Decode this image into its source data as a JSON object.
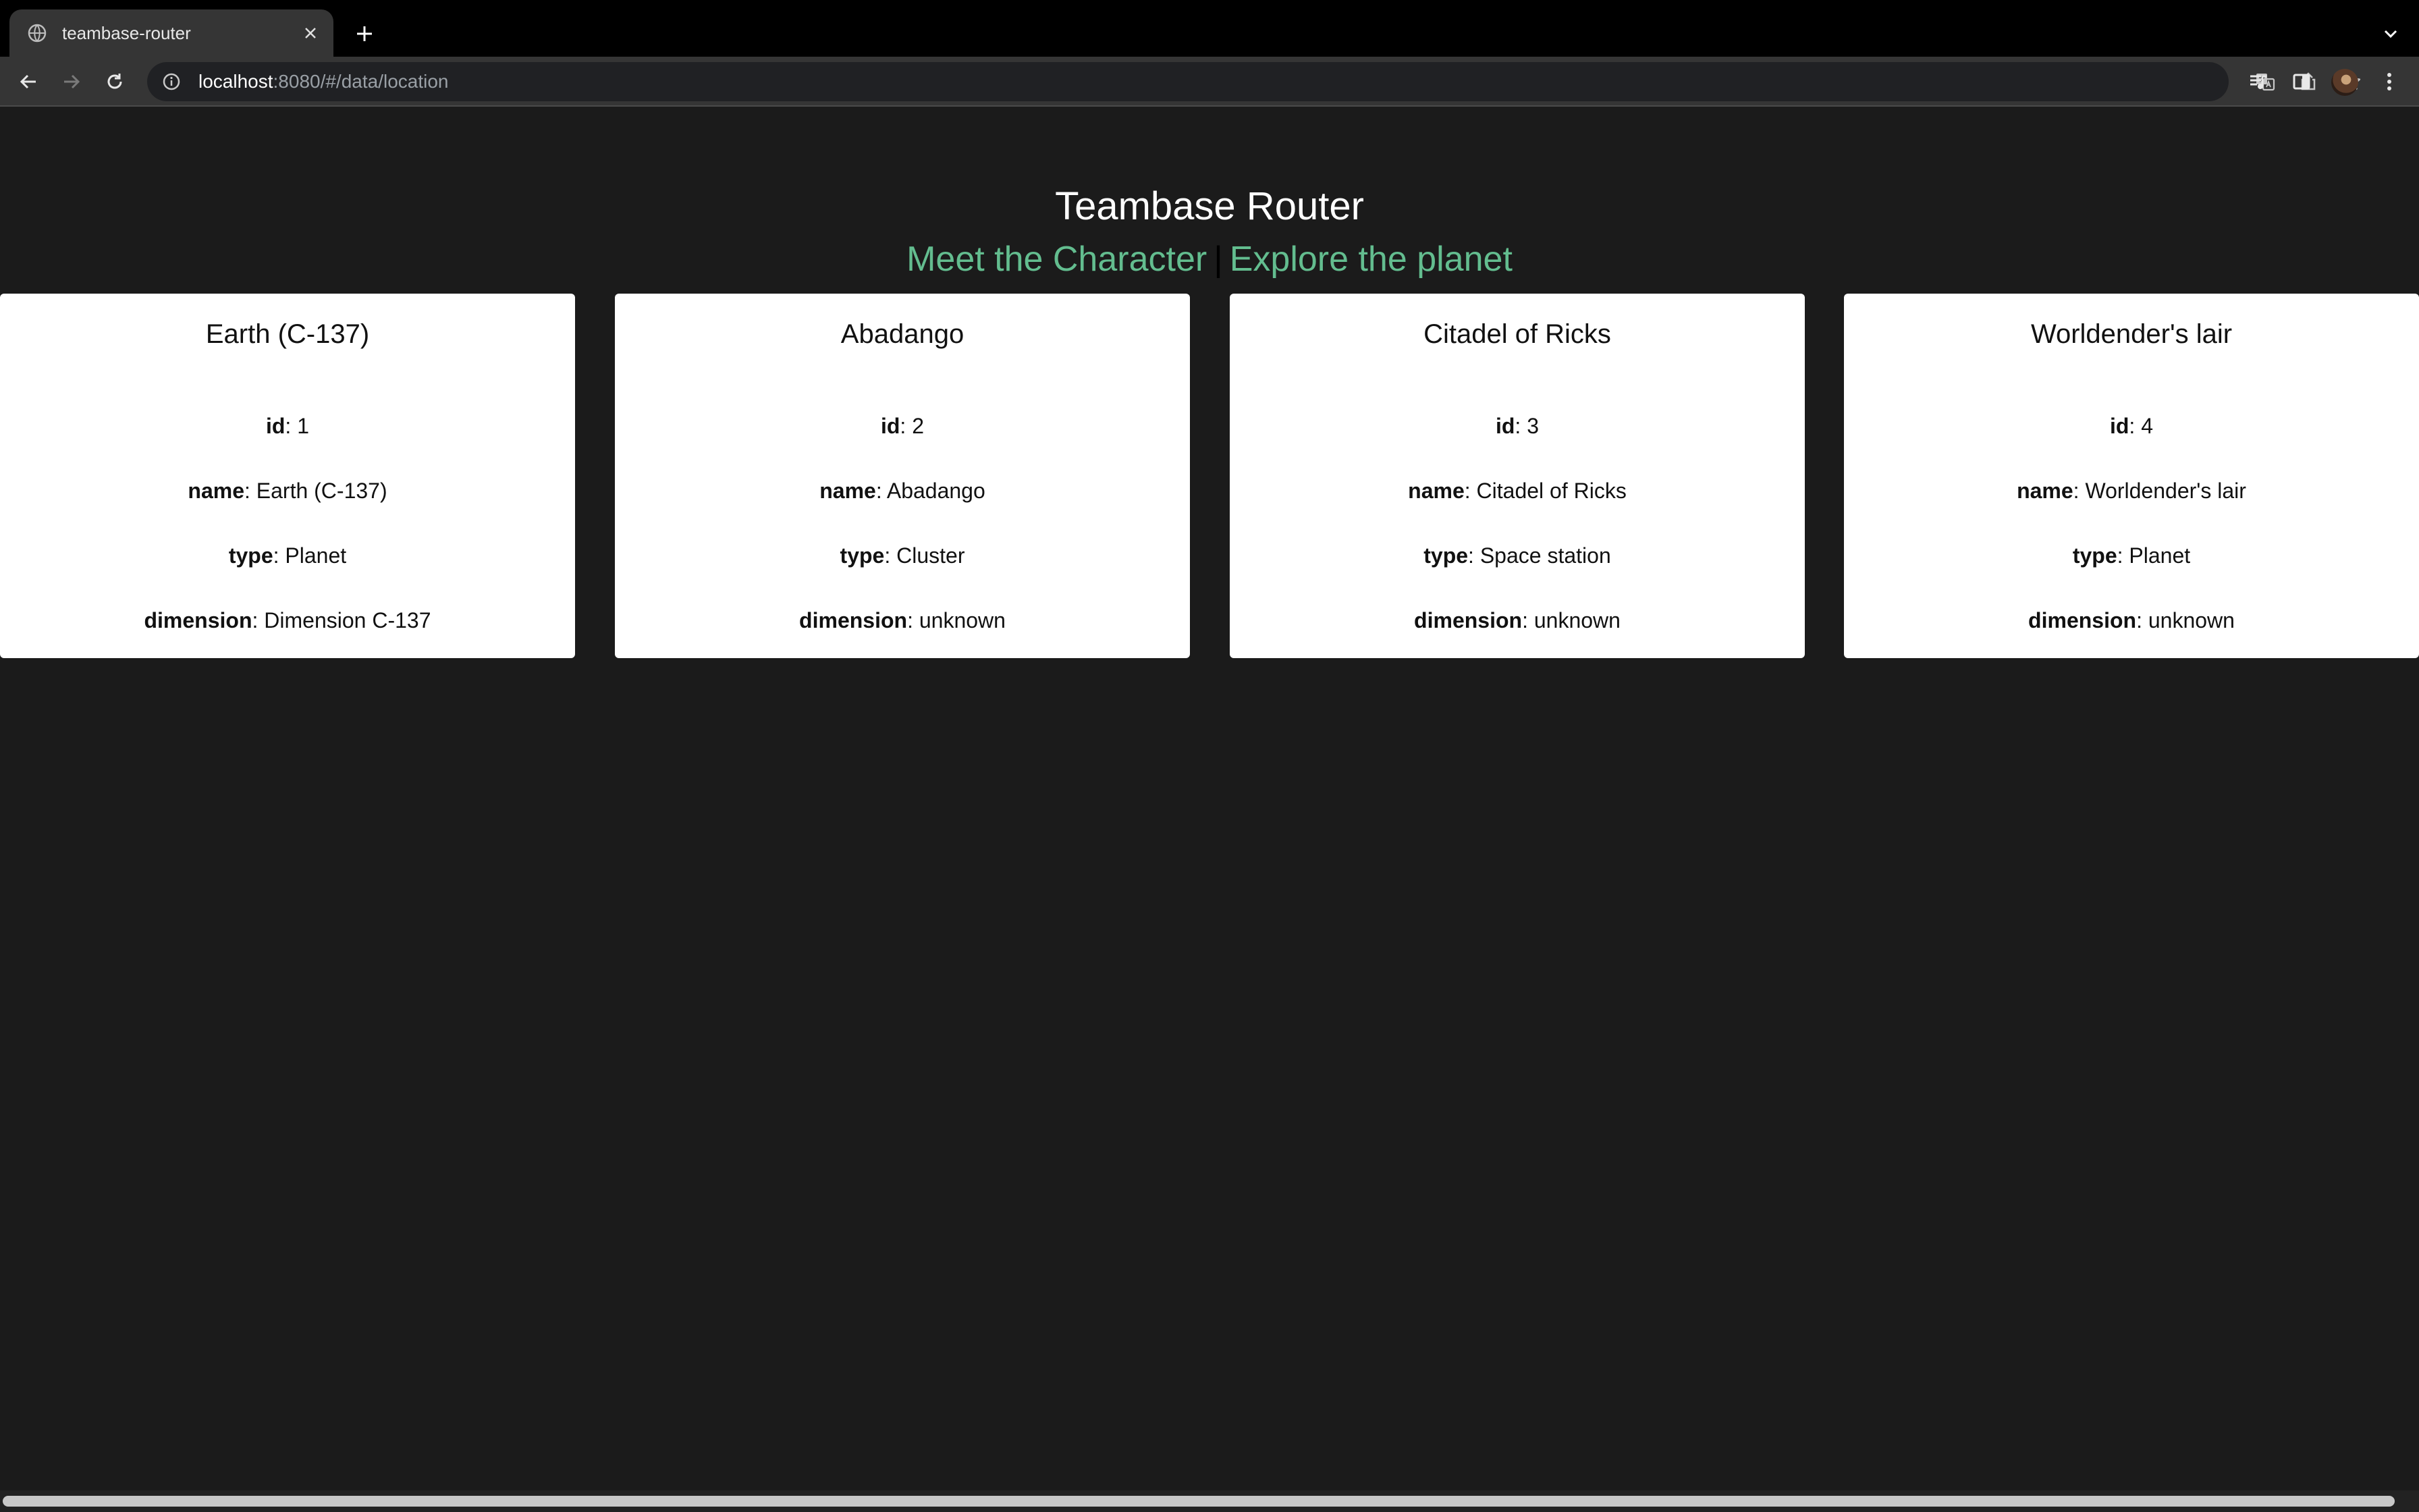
{
  "browser": {
    "tab_title": "teambase-router",
    "url_host": "localhost",
    "url_rest": ":8080/#/data/location",
    "icons": [
      "globe-icon",
      "close-icon",
      "plus-icon",
      "chevron-down-icon",
      "back-arrow-icon",
      "forward-arrow-icon",
      "reload-icon",
      "info-icon",
      "translate-icon",
      "share-icon",
      "star-icon",
      "reading-list-icon",
      "side-panel-icon",
      "kebab-menu-icon"
    ]
  },
  "page": {
    "title": "Teambase Router",
    "nav": {
      "character": "Meet the Character",
      "separator": "|",
      "planet": "Explore the planet"
    },
    "link_color": "#63bd8f"
  },
  "labels": {
    "id": "id",
    "name": "name",
    "type": "type",
    "dimension": "dimension",
    "colon": ": "
  },
  "locations": [
    {
      "title": "Earth (C-137)",
      "id": "1",
      "name": "Earth (C-137)",
      "type": "Planet",
      "dimension": "Dimension C-137"
    },
    {
      "title": "Abadango",
      "id": "2",
      "name": "Abadango",
      "type": "Cluster",
      "dimension": "unknown"
    },
    {
      "title": "Citadel of Ricks",
      "id": "3",
      "name": "Citadel of Ricks",
      "type": "Space station",
      "dimension": "unknown"
    },
    {
      "title": "Worldender's lair",
      "id": "4",
      "name": "Worldender's lair",
      "type": "Planet",
      "dimension": "unknown"
    }
  ]
}
